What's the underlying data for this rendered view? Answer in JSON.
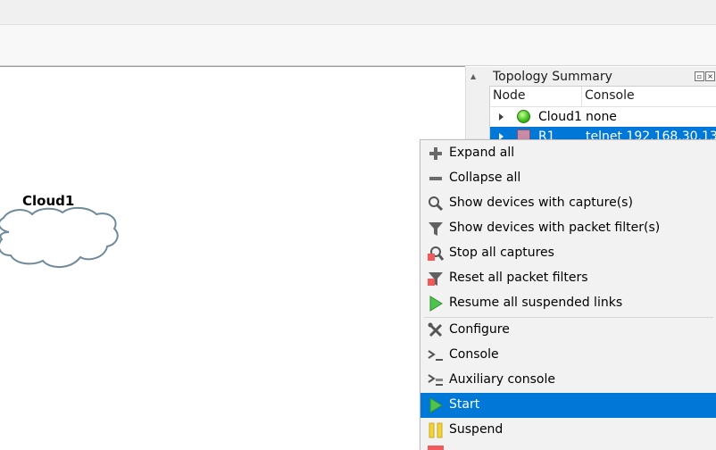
{
  "topology_summary": {
    "title": "Topology Summary",
    "columns": {
      "node": "Node",
      "console": "Console"
    },
    "rows": [
      {
        "node": "Cloud1",
        "console": "none",
        "icon": "green-status-icon"
      },
      {
        "node": "R1",
        "console": "telnet 192.168.30.13...",
        "icon": "router-icon"
      }
    ]
  },
  "canvas": {
    "cloud_label": "Cloud1"
  },
  "context_menu": {
    "items": [
      {
        "label": "Expand all",
        "icon": "plus-icon"
      },
      {
        "label": "Collapse all",
        "icon": "minus-icon"
      },
      {
        "label": "Show devices with capture(s)",
        "icon": "magnifier-icon"
      },
      {
        "label": "Show devices with packet filter(s)",
        "icon": "funnel-icon"
      },
      {
        "label": "Stop all captures",
        "icon": "magnifier-stop-icon"
      },
      {
        "label": "Reset all packet filters",
        "icon": "funnel-stop-icon"
      },
      {
        "label": "Resume all suspended links",
        "icon": "play-icon"
      },
      {
        "label": "Configure",
        "icon": "wrench-screwdriver-icon"
      },
      {
        "label": "Console",
        "icon": "console-icon"
      },
      {
        "label": "Auxiliary console",
        "icon": "aux-console-icon"
      },
      {
        "label": "Start",
        "icon": "start-icon"
      },
      {
        "label": "Suspend",
        "icon": "pause-icon"
      }
    ],
    "selected": "Start"
  },
  "colors": {
    "selection": "#0078d7",
    "play_green": "#4ec34e",
    "pause_yellow": "#f3d33c",
    "stop_red": "#f05a5a"
  }
}
